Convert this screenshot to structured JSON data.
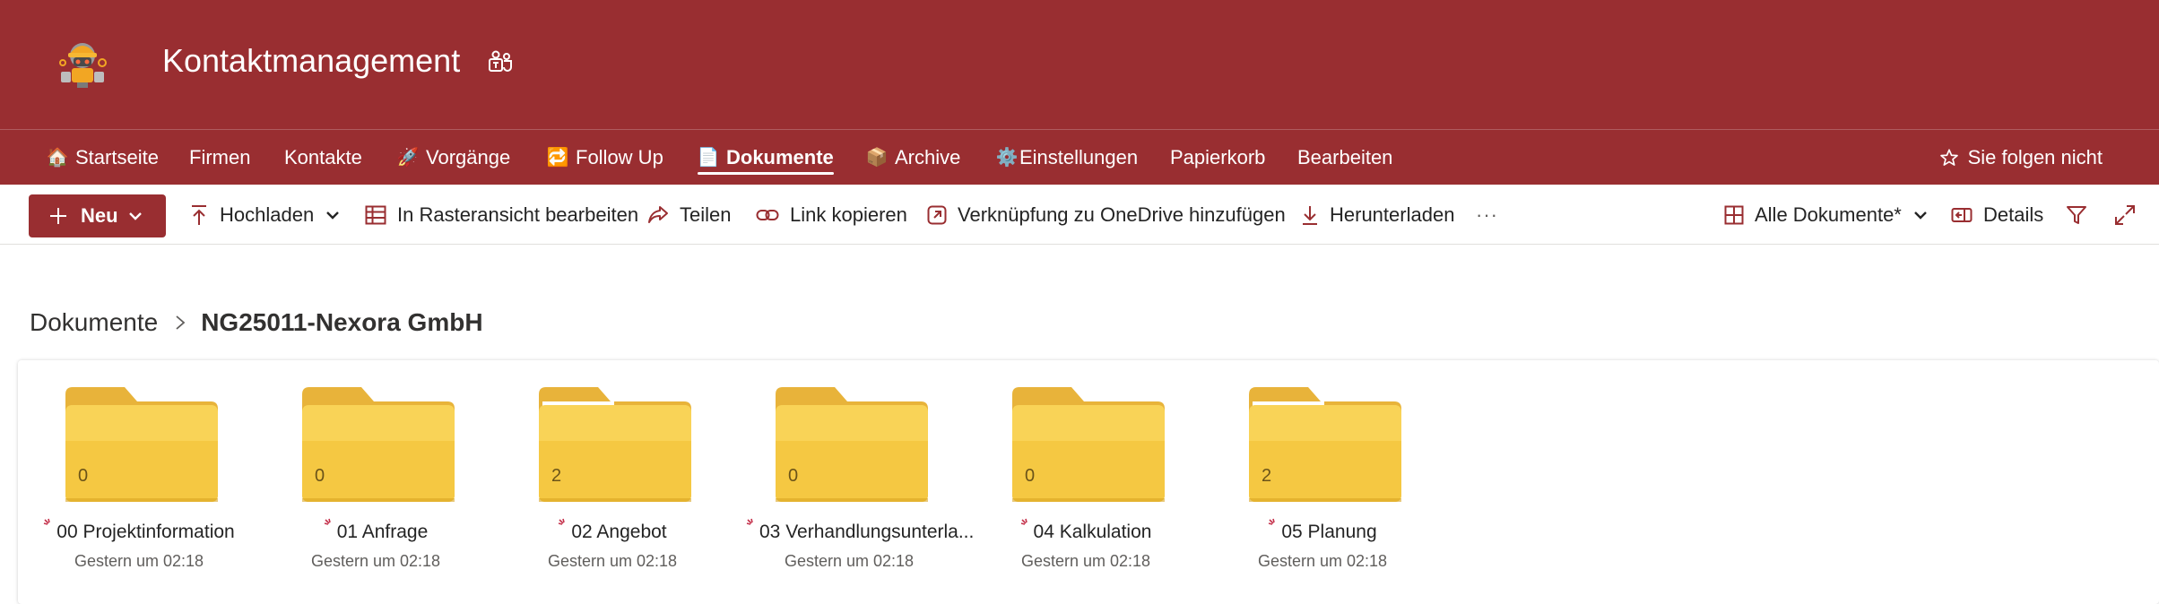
{
  "site": {
    "title": "Kontaktmanagement",
    "logo_icon": "robot-logo-icon",
    "teams_icon": "teams-icon"
  },
  "nav": {
    "items": [
      {
        "label": "Startseite",
        "icon": "🏠"
      },
      {
        "label": "Firmen",
        "icon": ""
      },
      {
        "label": "Kontakte",
        "icon": ""
      },
      {
        "label": "Vorgänge",
        "icon": "🚀"
      },
      {
        "label": "Follow Up",
        "icon": "🔁"
      },
      {
        "label": "Dokumente",
        "icon": "📄"
      },
      {
        "label": "Archive",
        "icon": "📦"
      },
      {
        "label": "Einstellungen",
        "icon": "⚙️"
      },
      {
        "label": "Papierkorb",
        "icon": ""
      },
      {
        "label": "Bearbeiten",
        "icon": ""
      }
    ],
    "active": "Dokumente",
    "follow_label": "Sie folgen nicht"
  },
  "toolbar": {
    "new_label": "Neu",
    "upload_label": "Hochladen",
    "grid_edit_label": "In Rasteransicht bearbeiten",
    "share_label": "Teilen",
    "copy_link_label": "Link kopieren",
    "onedrive_label": "Verknüpfung zu OneDrive hinzufügen",
    "download_label": "Herunterladen",
    "more_label": "···",
    "view_label": "Alle Dokumente*",
    "details_label": "Details"
  },
  "breadcrumb": {
    "root": "Dokumente",
    "current": "NG25011-Nexora GmbH"
  },
  "folders": [
    {
      "name": "00 Projektinformation",
      "count": "0",
      "modified": "Gestern um 02:18",
      "has_files": false
    },
    {
      "name": "01 Anfrage",
      "count": "0",
      "modified": "Gestern um 02:18",
      "has_files": false
    },
    {
      "name": "02 Angebot",
      "count": "2",
      "modified": "Gestern um 02:18",
      "has_files": true
    },
    {
      "name": "03 Verhandlungsunterla...",
      "count": "0",
      "modified": "Gestern um 02:18",
      "has_files": false
    },
    {
      "name": "04 Kalkulation",
      "count": "0",
      "modified": "Gestern um 02:18",
      "has_files": false
    },
    {
      "name": "05 Planung",
      "count": "2",
      "modified": "Gestern um 02:18",
      "has_files": true
    }
  ],
  "colors": {
    "brand": "#992e31",
    "folder_front": "#f5c842",
    "folder_back": "#e8b33a"
  }
}
